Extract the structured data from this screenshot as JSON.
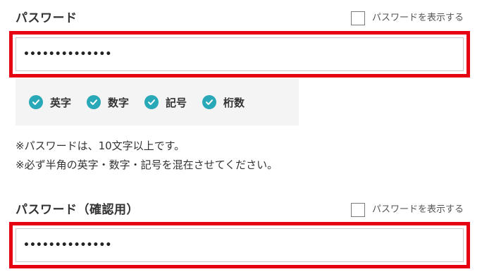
{
  "password_field": {
    "label": "パスワード",
    "show_password_label": "パスワードを表示する",
    "masked_value": "••••••••••••••"
  },
  "requirements": [
    {
      "label": "英字",
      "met": true
    },
    {
      "label": "数字",
      "met": true
    },
    {
      "label": "記号",
      "met": true
    },
    {
      "label": "桁数",
      "met": true
    }
  ],
  "notes": {
    "line1": "※パスワードは、10文字以上です。",
    "line2": "※必ず半角の英字・数字・記号を混在させてください。"
  },
  "confirm_field": {
    "label": "パスワード（確認用）",
    "show_password_label": "パスワードを表示する",
    "masked_value": "••••••••••••••"
  },
  "colors": {
    "highlight": "#e60012",
    "check": "#29a8b8",
    "check_area_bg": "#f4f4f4"
  },
  "icons": {
    "requirement": "checkmark-circle-icon",
    "toggle": "checkbox-icon"
  }
}
